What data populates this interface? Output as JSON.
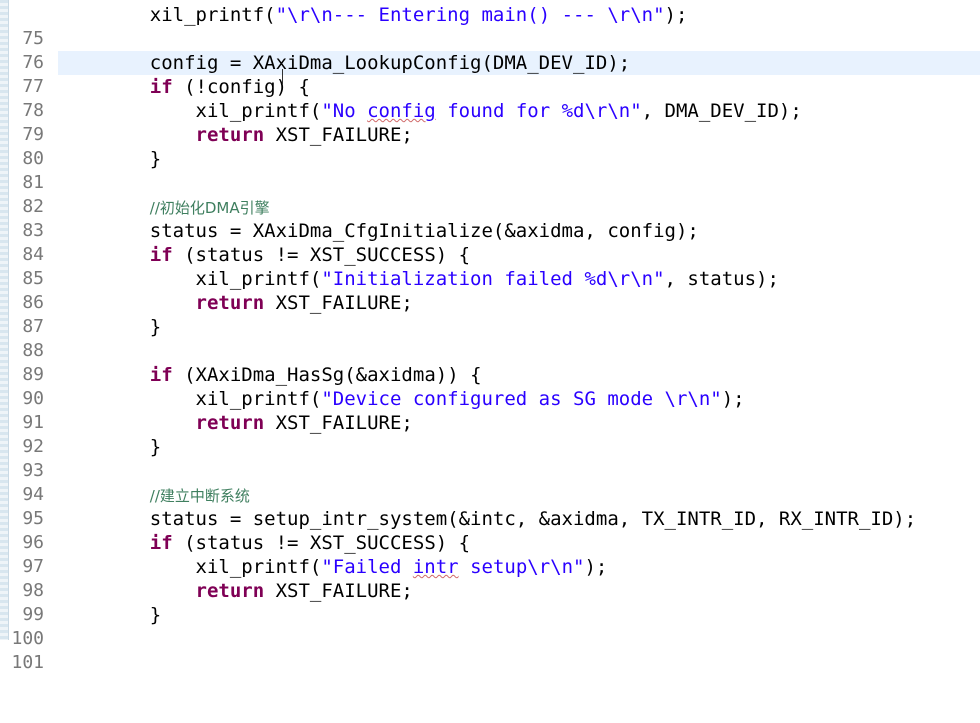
{
  "editor": {
    "lines": [
      {
        "number": "75",
        "code": "    xil_printf(\"\\r\\n--- Entering main() --- \\r\\n\");"
      },
      {
        "number": "76",
        "code": ""
      },
      {
        "number": "77",
        "code": "    config = XAxiDma_LookupConfig(DMA_DEV_ID);"
      },
      {
        "number": "78",
        "code": "    if (!config) {"
      },
      {
        "number": "79",
        "code": "        xil_printf(\"No config found for %d\\r\\n\", DMA_DEV_ID);"
      },
      {
        "number": "80",
        "code": "        return XST_FAILURE;"
      },
      {
        "number": "81",
        "code": "    }"
      },
      {
        "number": "82",
        "code": ""
      },
      {
        "number": "83",
        "code": "    //初始化DMA引擎"
      },
      {
        "number": "84",
        "code": "    status = XAxiDma_CfgInitialize(&axidma, config);"
      },
      {
        "number": "85",
        "code": "    if (status != XST_SUCCESS) {"
      },
      {
        "number": "86",
        "code": "        xil_printf(\"Initialization failed %d\\r\\n\", status);"
      },
      {
        "number": "87",
        "code": "        return XST_FAILURE;"
      },
      {
        "number": "88",
        "code": "    }"
      },
      {
        "number": "89",
        "code": ""
      },
      {
        "number": "90",
        "code": "    if (XAxiDma_HasSg(&axidma)) {"
      },
      {
        "number": "91",
        "code": "        xil_printf(\"Device configured as SG mode \\r\\n\");"
      },
      {
        "number": "92",
        "code": "        return XST_FAILURE;"
      },
      {
        "number": "93",
        "code": "    }"
      },
      {
        "number": "94",
        "code": ""
      },
      {
        "number": "95",
        "code": "    //建立中断系统"
      },
      {
        "number": "96",
        "code": "    status = setup_intr_system(&intc, &axidma, TX_INTR_ID, RX_INTR_ID);"
      },
      {
        "number": "97",
        "code": "    if (status != XST_SUCCESS) {"
      },
      {
        "number": "98",
        "code": "        xil_printf(\"Failed intr setup\\r\\n\");"
      },
      {
        "number": "99",
        "code": "        return XST_FAILURE;"
      },
      {
        "number": "100",
        "code": "    }"
      },
      {
        "number": "101",
        "code": ""
      }
    ]
  },
  "colors": {
    "keyword": "#7f0055",
    "string": "#2a00ff",
    "comment": "#3f7f5f",
    "line_number": "#787878",
    "current_line": "#e8f2fe"
  }
}
